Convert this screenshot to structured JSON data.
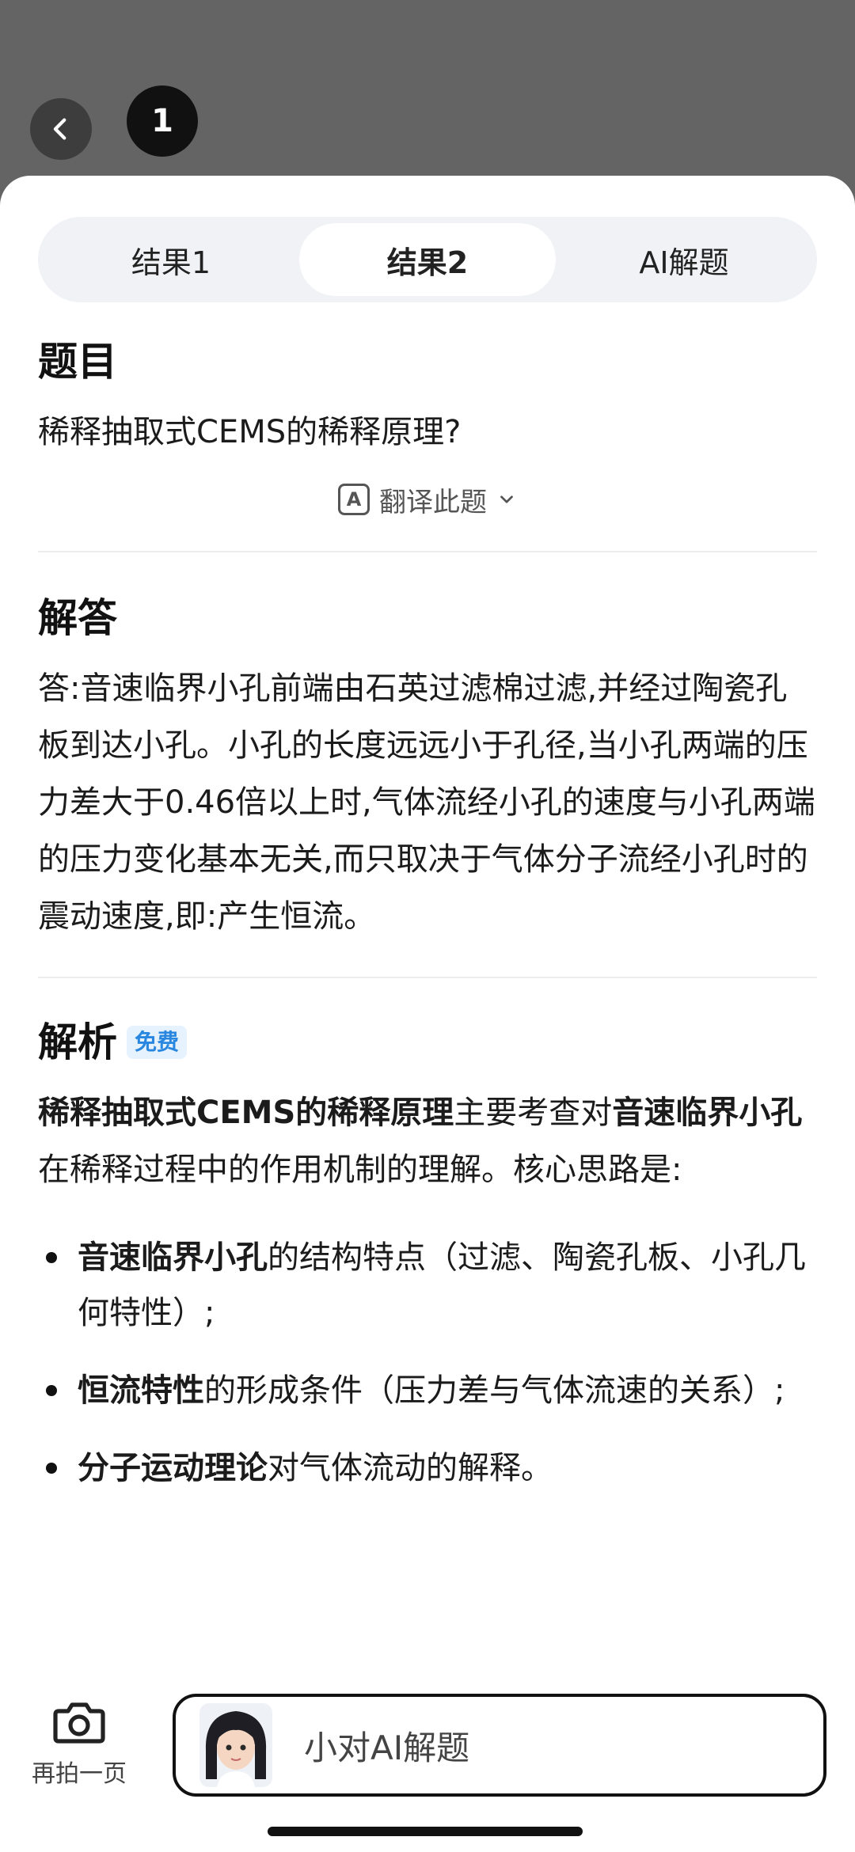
{
  "header": {
    "page_number": "1"
  },
  "tabs": [
    {
      "label": "结果1",
      "active": false
    },
    {
      "label": "结果2",
      "active": true
    },
    {
      "label": "AI解题",
      "active": false
    }
  ],
  "question": {
    "title": "题目",
    "text": "稀释抽取式CEMS的稀释原理?",
    "translate_label": "翻译此题"
  },
  "answer": {
    "title": "解答",
    "text": "答:音速临界小孔前端由石英过滤棉过滤,并经过陶瓷孔板到达小孔。小孔的长度远远小于孔径,当小孔两端的压力差大于0.46倍以上时,气体流经小孔的速度与小孔两端的压力变化基本无关,而只取决于气体分子流经小孔时的震动速度,即:产生恒流。"
  },
  "analysis": {
    "title": "解析",
    "badge": "免费",
    "intro_bold1": "稀释抽取式CEMS的稀释原理",
    "intro_mid": "主要考查对",
    "intro_bold2": "音速临界小孔",
    "intro_end": "在稀释过程中的作用机制的理解。核心思路是:",
    "bullets": [
      {
        "bold": "音速临界小孔",
        "text": "的结构特点（过滤、陶瓷孔板、小孔几何特性）;"
      },
      {
        "bold": "恒流特性",
        "text": "的形成条件（压力差与气体流速的关系）;"
      },
      {
        "bold": "分子运动理论",
        "text": "对气体流动的解释。"
      }
    ]
  },
  "bottom": {
    "reshoot_label": "再拍一页",
    "ai_label": "小对AI解题"
  }
}
